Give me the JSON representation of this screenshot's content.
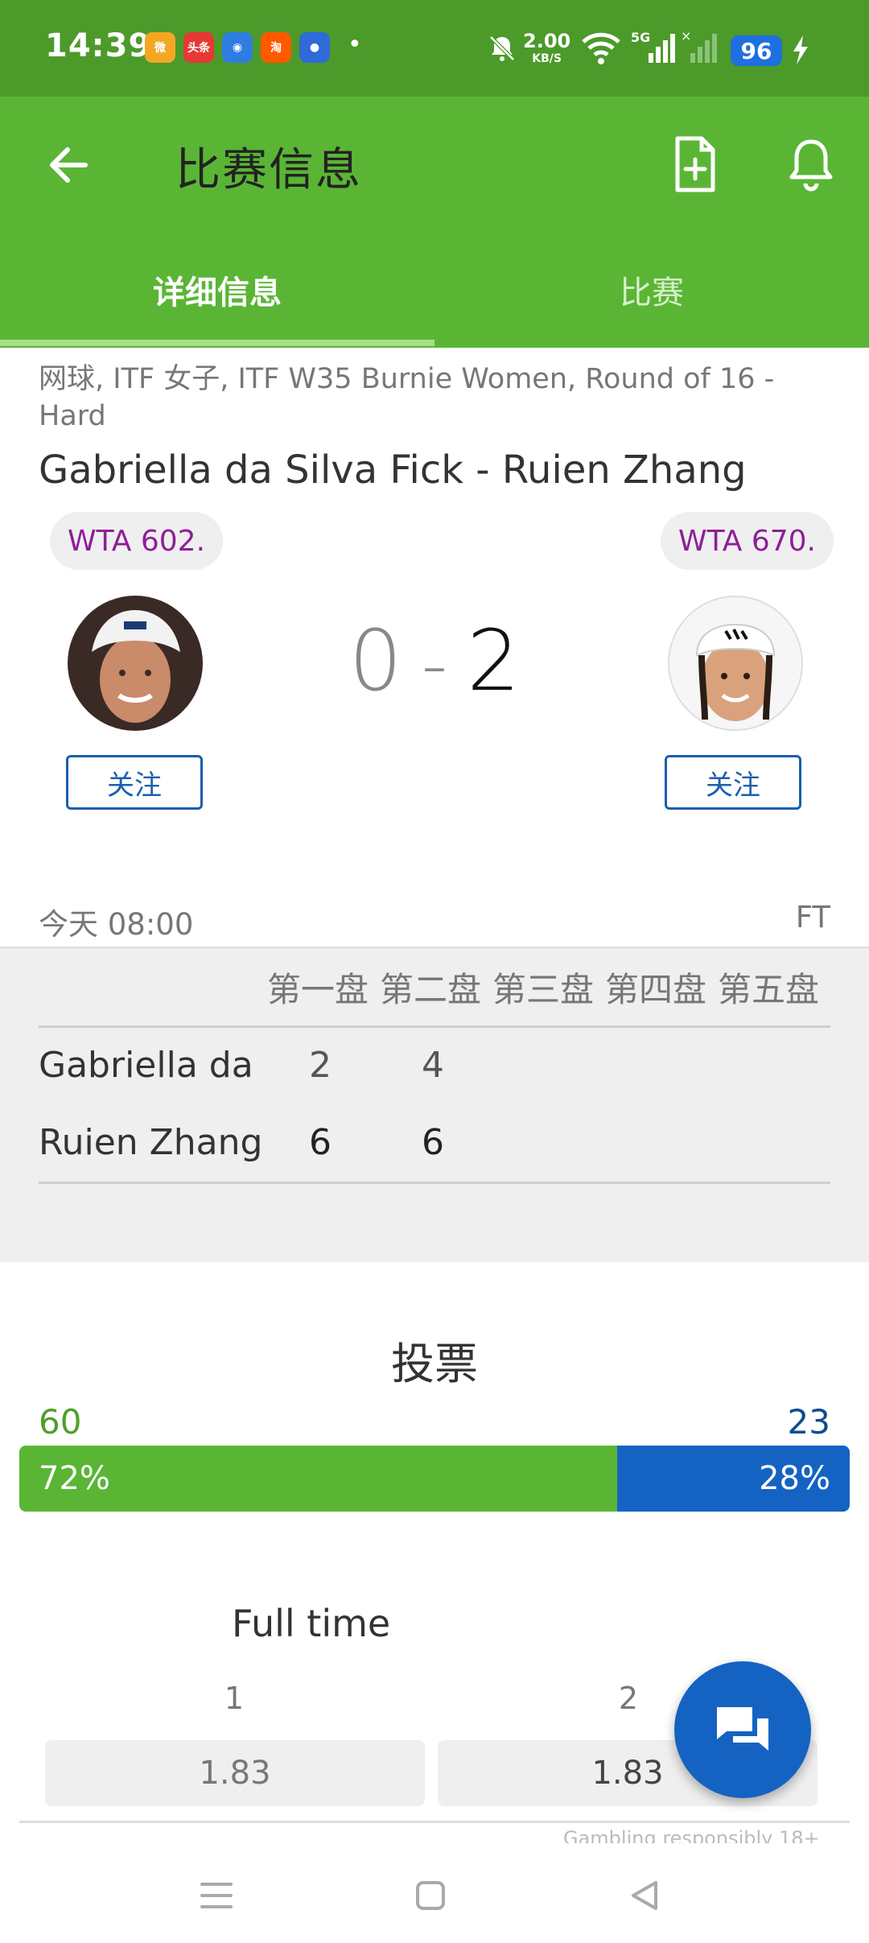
{
  "status_bar": {
    "time": "14:39",
    "app_icons": [
      {
        "name": "weibo-icon",
        "label": "微",
        "color": "#f5a623"
      },
      {
        "name": "toutiao-icon",
        "label": "头条",
        "color": "#e53935"
      },
      {
        "name": "browser-icon",
        "label": "◉",
        "color": "#2f7de1"
      },
      {
        "name": "taobao-icon",
        "label": "淘",
        "color": "#ff5a00"
      },
      {
        "name": "app-icon",
        "label": "●",
        "color": "#2e6bd9"
      }
    ],
    "net_speed_value": "2.00",
    "net_speed_unit": "KB/S",
    "network": "5G",
    "battery": "96"
  },
  "app_bar": {
    "title": "比赛信息",
    "tabs": [
      {
        "label": "详细信息",
        "active": true
      },
      {
        "label": "比赛",
        "active": false
      }
    ]
  },
  "match": {
    "breadcrumb": "网球, ITF 女子, ITF W35 Burnie Women, Round of 16 - Hard",
    "title": "Gabriella da Silva Fick - Ruien Zhang",
    "player1": {
      "rank": "WTA 602.",
      "follow_label": "关注"
    },
    "player2": {
      "rank": "WTA 670.",
      "follow_label": "关注"
    },
    "score_home": "0",
    "score_sep": "-",
    "score_away": "2",
    "time": "今天 08:00",
    "status": "FT"
  },
  "score_table": {
    "headers": [
      "第一盘",
      "第二盘",
      "第三盘",
      "第四盘",
      "第五盘"
    ],
    "rows": [
      {
        "name": "Gabriella da ...",
        "sets": [
          "2",
          "4"
        ]
      },
      {
        "name": "Ruien Zhang",
        "sets": [
          "6",
          "6"
        ]
      }
    ]
  },
  "voting": {
    "title": "投票",
    "left_count": "60",
    "right_count": "23",
    "left_pct": "72%",
    "right_pct": "28%",
    "left_fraction": 0.72,
    "colors": {
      "left": "#5ab535",
      "right": "#1463c2"
    }
  },
  "odds": {
    "title": "Full time",
    "headers": [
      "1",
      "2"
    ],
    "values": [
      "1.83",
      "1.83"
    ],
    "note": "Gambling responsibly 18+"
  },
  "colors": {
    "accent_green": "#5ab535",
    "status_green": "#4c9a2a",
    "link_blue": "#1a5fae",
    "rank_purple": "#8e1f98"
  }
}
